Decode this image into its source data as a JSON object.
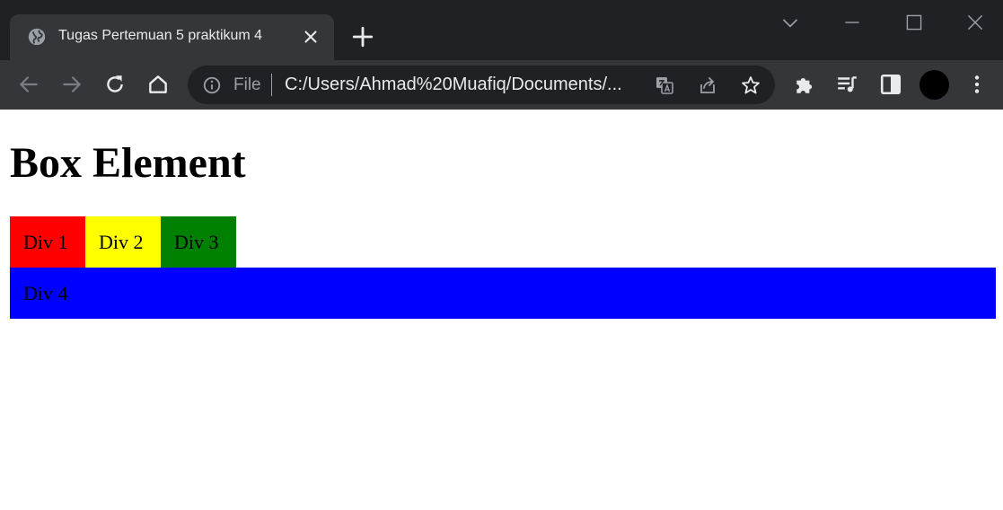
{
  "browser": {
    "tab": {
      "title": "Tugas Pertemuan 5 praktikum 4",
      "favicon": "globe-icon"
    },
    "address_bar": {
      "scheme_label": "File",
      "url": "C:/Users/Ahmad%20Muafiq/Documents/..."
    },
    "icons": {
      "back": "arrow-left-icon",
      "forward": "arrow-right-icon",
      "reload": "reload-icon",
      "home": "home-icon",
      "translate": "translate-icon",
      "share": "share-icon",
      "bookmark": "star-icon",
      "extensions": "puzzle-icon",
      "media": "media-playlist-icon",
      "side_panel": "side-panel-icon",
      "menu": "kebab-menu-icon"
    },
    "colors": {
      "frame": "#202124",
      "toolbar": "#35363a",
      "text": "#e8eaed",
      "muted": "#9aa0a6"
    }
  },
  "page": {
    "title": "Box Element",
    "boxes": [
      {
        "label": "Div 1",
        "color": "#ff0000"
      },
      {
        "label": "Div 2",
        "color": "#ffff00"
      },
      {
        "label": "Div 3",
        "color": "#008000"
      },
      {
        "label": "Div 4",
        "color": "#0000ff"
      }
    ]
  }
}
